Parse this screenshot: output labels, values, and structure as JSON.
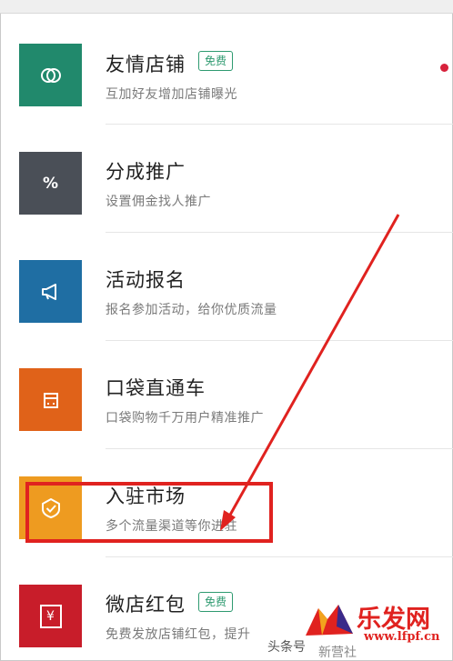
{
  "items": [
    {
      "title": "友情店铺",
      "badge": "免费",
      "subtitle": "互加好友增加店铺曝光",
      "color": "#21896c",
      "icon": "link-circles-icon"
    },
    {
      "title": "分成推广",
      "badge": "",
      "subtitle": "设置佣金找人推广",
      "color": "#4a4f57",
      "icon": "percent-icon",
      "icon_glyph": "%"
    },
    {
      "title": "活动报名",
      "badge": "",
      "subtitle": "报名参加活动，给你优质流量",
      "color": "#1f6ea3",
      "icon": "megaphone-icon"
    },
    {
      "title": "口袋直通车",
      "badge": "",
      "subtitle": "口袋购物千万用户精准推广",
      "color": "#e06219",
      "icon": "shop-icon"
    },
    {
      "title": "入驻市场",
      "badge": "",
      "subtitle": "多个流量渠道等你进驻",
      "color": "#ee9b20",
      "icon": "check-shield-icon"
    },
    {
      "title": "微店红包",
      "badge": "免费",
      "subtitle": "免费发放店铺红包，提升",
      "color": "#c81d2a",
      "icon": "yen-envelope-icon",
      "icon_glyph": "¥"
    }
  ],
  "annotation": {
    "color": "#e0221f"
  },
  "watermark": {
    "brand": "乐发网",
    "url": "www.lfpf.cn",
    "media": "头条号",
    "author": "新营社"
  },
  "colors": {
    "badge": "#2e9a70",
    "dot": "#d7213b"
  }
}
